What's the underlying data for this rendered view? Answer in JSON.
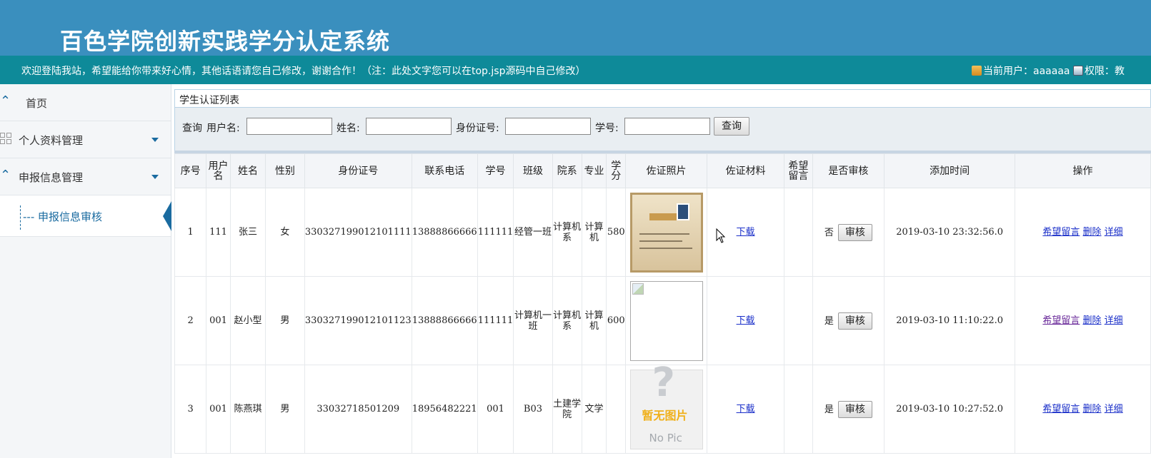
{
  "header": {
    "title": "百色学院创新实践学分认定系统",
    "welcome": "欢迎登陆我站，希望能给你带来好心情，其他话语请您自己修改，谢谢合作！（注：此处文字您可以在top.jsp源码中自己修改）",
    "current_user_label": "当前用户：",
    "current_user": "aaaaaa",
    "permission_label": "权限：",
    "permission": "教"
  },
  "sidebar": {
    "items": [
      {
        "label": "首页"
      },
      {
        "label": "个人资料管理"
      },
      {
        "label": "申报信息管理"
      }
    ],
    "sub_items": [
      {
        "prefix": "---",
        "label": "申报信息审核"
      }
    ]
  },
  "panel": {
    "title": "学生认证列表"
  },
  "search": {
    "query_label": "查询",
    "username_label": "用户名:",
    "name_label": "姓名:",
    "idcard_label": "身份证号:",
    "student_no_label": "学号:",
    "username_value": "",
    "name_value": "",
    "idcard_value": "",
    "student_no_value": "",
    "button": "查询"
  },
  "table": {
    "headers": [
      "序号",
      "用户名",
      "姓名",
      "性别",
      "身份证号",
      "联系电话",
      "学号",
      "班级",
      "院系",
      "专业",
      "学分",
      "佐证照片",
      "佐证材料",
      "希望留言",
      "是否审核",
      "添加时间",
      "操作"
    ],
    "rows": [
      {
        "no": "1",
        "username": "111",
        "name": "张三",
        "gender": "女",
        "idcard": "330327199012101111",
        "phone": "13888866666",
        "student_no": "111111",
        "class": "经管一班",
        "dept": "计算机系",
        "major": "计算机",
        "credit": "580",
        "photo": "certificate",
        "material": "下载",
        "message": "",
        "audited": "否",
        "audit_button": "审核",
        "time": "2019-03-10 23:32:56.0",
        "op_message": "希望留言",
        "op_delete": "删除",
        "op_detail": "详细"
      },
      {
        "no": "2",
        "username": "001",
        "name": "赵小型",
        "gender": "男",
        "idcard": "330327199012101123",
        "phone": "13888866666",
        "student_no": "111111",
        "class": "计算机一班",
        "dept": "计算机系",
        "major": "计算机",
        "credit": "600",
        "photo": "broken",
        "material": "下载",
        "message": "",
        "audited": "是",
        "audit_button": "审核",
        "time": "2019-03-10 11:10:22.0",
        "op_message": "希望留言",
        "op_delete": "删除",
        "op_detail": "详细"
      },
      {
        "no": "3",
        "username": "001",
        "name": "陈燕琪",
        "gender": "男",
        "idcard": "33032718501209",
        "phone": "18956482221",
        "student_no": "001",
        "class": "B03",
        "dept": "土建学院",
        "major": "文学",
        "credit": "",
        "photo": "nopic",
        "material": "下载",
        "message": "",
        "audited": "是",
        "audit_button": "审核",
        "time": "2019-03-10 10:27:52.0",
        "op_message": "希望留言",
        "op_delete": "删除",
        "op_detail": "详细"
      }
    ]
  },
  "nopic": {
    "text1": "暂无图片",
    "text2": "No Pic"
  },
  "colors": {
    "header_bg": "#3a8fbe",
    "topbar_bg": "#0e8a99",
    "accent": "#1a6ba0",
    "link": "#1a2fc9"
  }
}
